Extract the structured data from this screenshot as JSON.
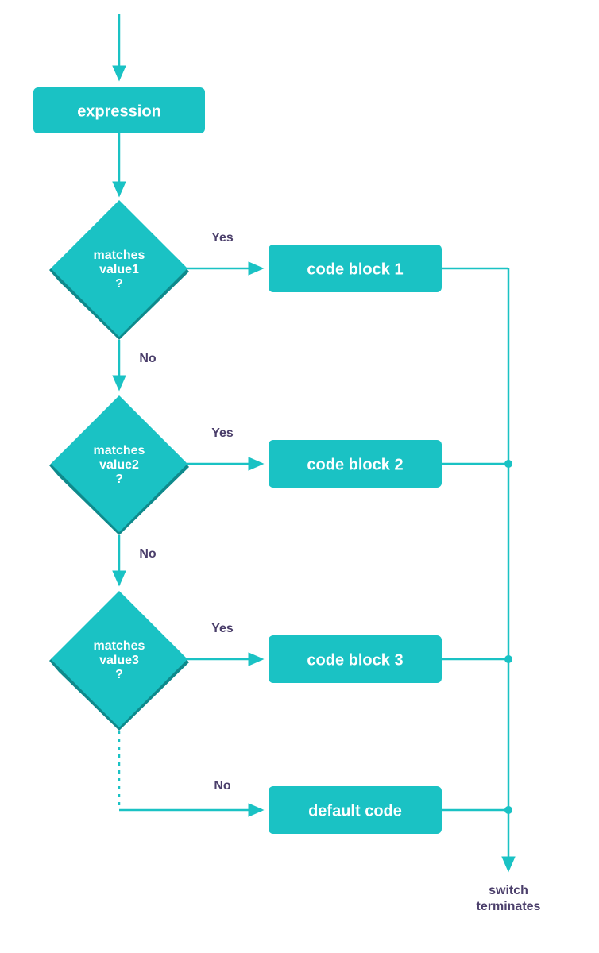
{
  "nodes": {
    "expression": "expression",
    "decision1_line1": "matches",
    "decision1_line2": "value1",
    "decision1_line3": "?",
    "decision2_line1": "matches",
    "decision2_line2": "value2",
    "decision2_line3": "?",
    "decision3_line1": "matches",
    "decision3_line2": "value3",
    "decision3_line3": "?",
    "block1": "code block 1",
    "block2": "code block 2",
    "block3": "code block 3",
    "default": "default code"
  },
  "labels": {
    "yes": "Yes",
    "no": "No",
    "terminate_line1": "switch",
    "terminate_line2": "terminates"
  },
  "colors": {
    "teal": "#1ac2c4",
    "tealDark": "#0e8a8c",
    "purple": "#4b3f6b"
  }
}
